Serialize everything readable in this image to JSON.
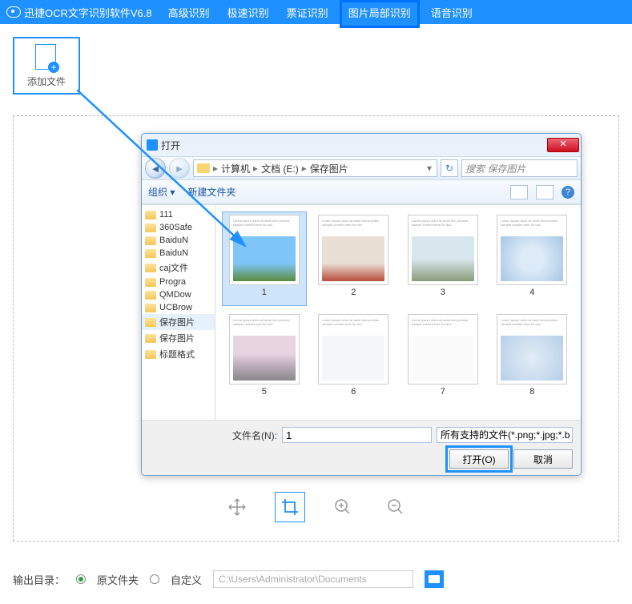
{
  "app": {
    "title": "迅捷OCR文字识别软件V6.8"
  },
  "menu": [
    "高级识别",
    "极速识别",
    "票证识别",
    "图片局部识别",
    "语音识别"
  ],
  "menu_highlight_index": 3,
  "addfile": {
    "label": "添加文件"
  },
  "dialog": {
    "title": "打开",
    "close": "✕",
    "nav_back": "◄",
    "nav_fwd": "►",
    "breadcrumb": [
      "计算机",
      "文档 (E:)",
      "保存图片"
    ],
    "refresh": "↻",
    "search_placeholder": "搜索 保存图片",
    "organize": "组织 ▾",
    "new_folder": "新建文件夹",
    "help": "?",
    "sidebar": [
      "111",
      "360Safe",
      "BaiduN",
      "BaiduN",
      "caj文件",
      "Progra",
      "QMDow",
      "UCBrow",
      "保存图片",
      "保存图片",
      "标题格式"
    ],
    "sidebar_selected_index": 8,
    "files": [
      {
        "label": "1",
        "cls": "sky"
      },
      {
        "label": "2",
        "cls": "balloons"
      },
      {
        "label": "3",
        "cls": "street"
      },
      {
        "label": "4",
        "cls": "laptops"
      },
      {
        "label": "5",
        "cls": "blossom"
      },
      {
        "label": "6",
        "cls": "icons"
      },
      {
        "label": "7",
        "cls": "plain"
      },
      {
        "label": "8",
        "cls": "devices"
      }
    ],
    "selected_file_index": 0,
    "filename_label": "文件名(N):",
    "filename_value": "1",
    "filter": "所有支持的文件(*.png;*.jpg;*.b",
    "open_btn": "打开(O)",
    "cancel_btn": "取消"
  },
  "tools": {
    "move": "move",
    "crop": "crop",
    "zoomin": "zoomin",
    "zoomout": "zoomout"
  },
  "output": {
    "label": "输出目录：",
    "opt1": "原文件夹",
    "opt2": "自定义",
    "path": "C:\\Users\\Administrator\\Documents"
  }
}
